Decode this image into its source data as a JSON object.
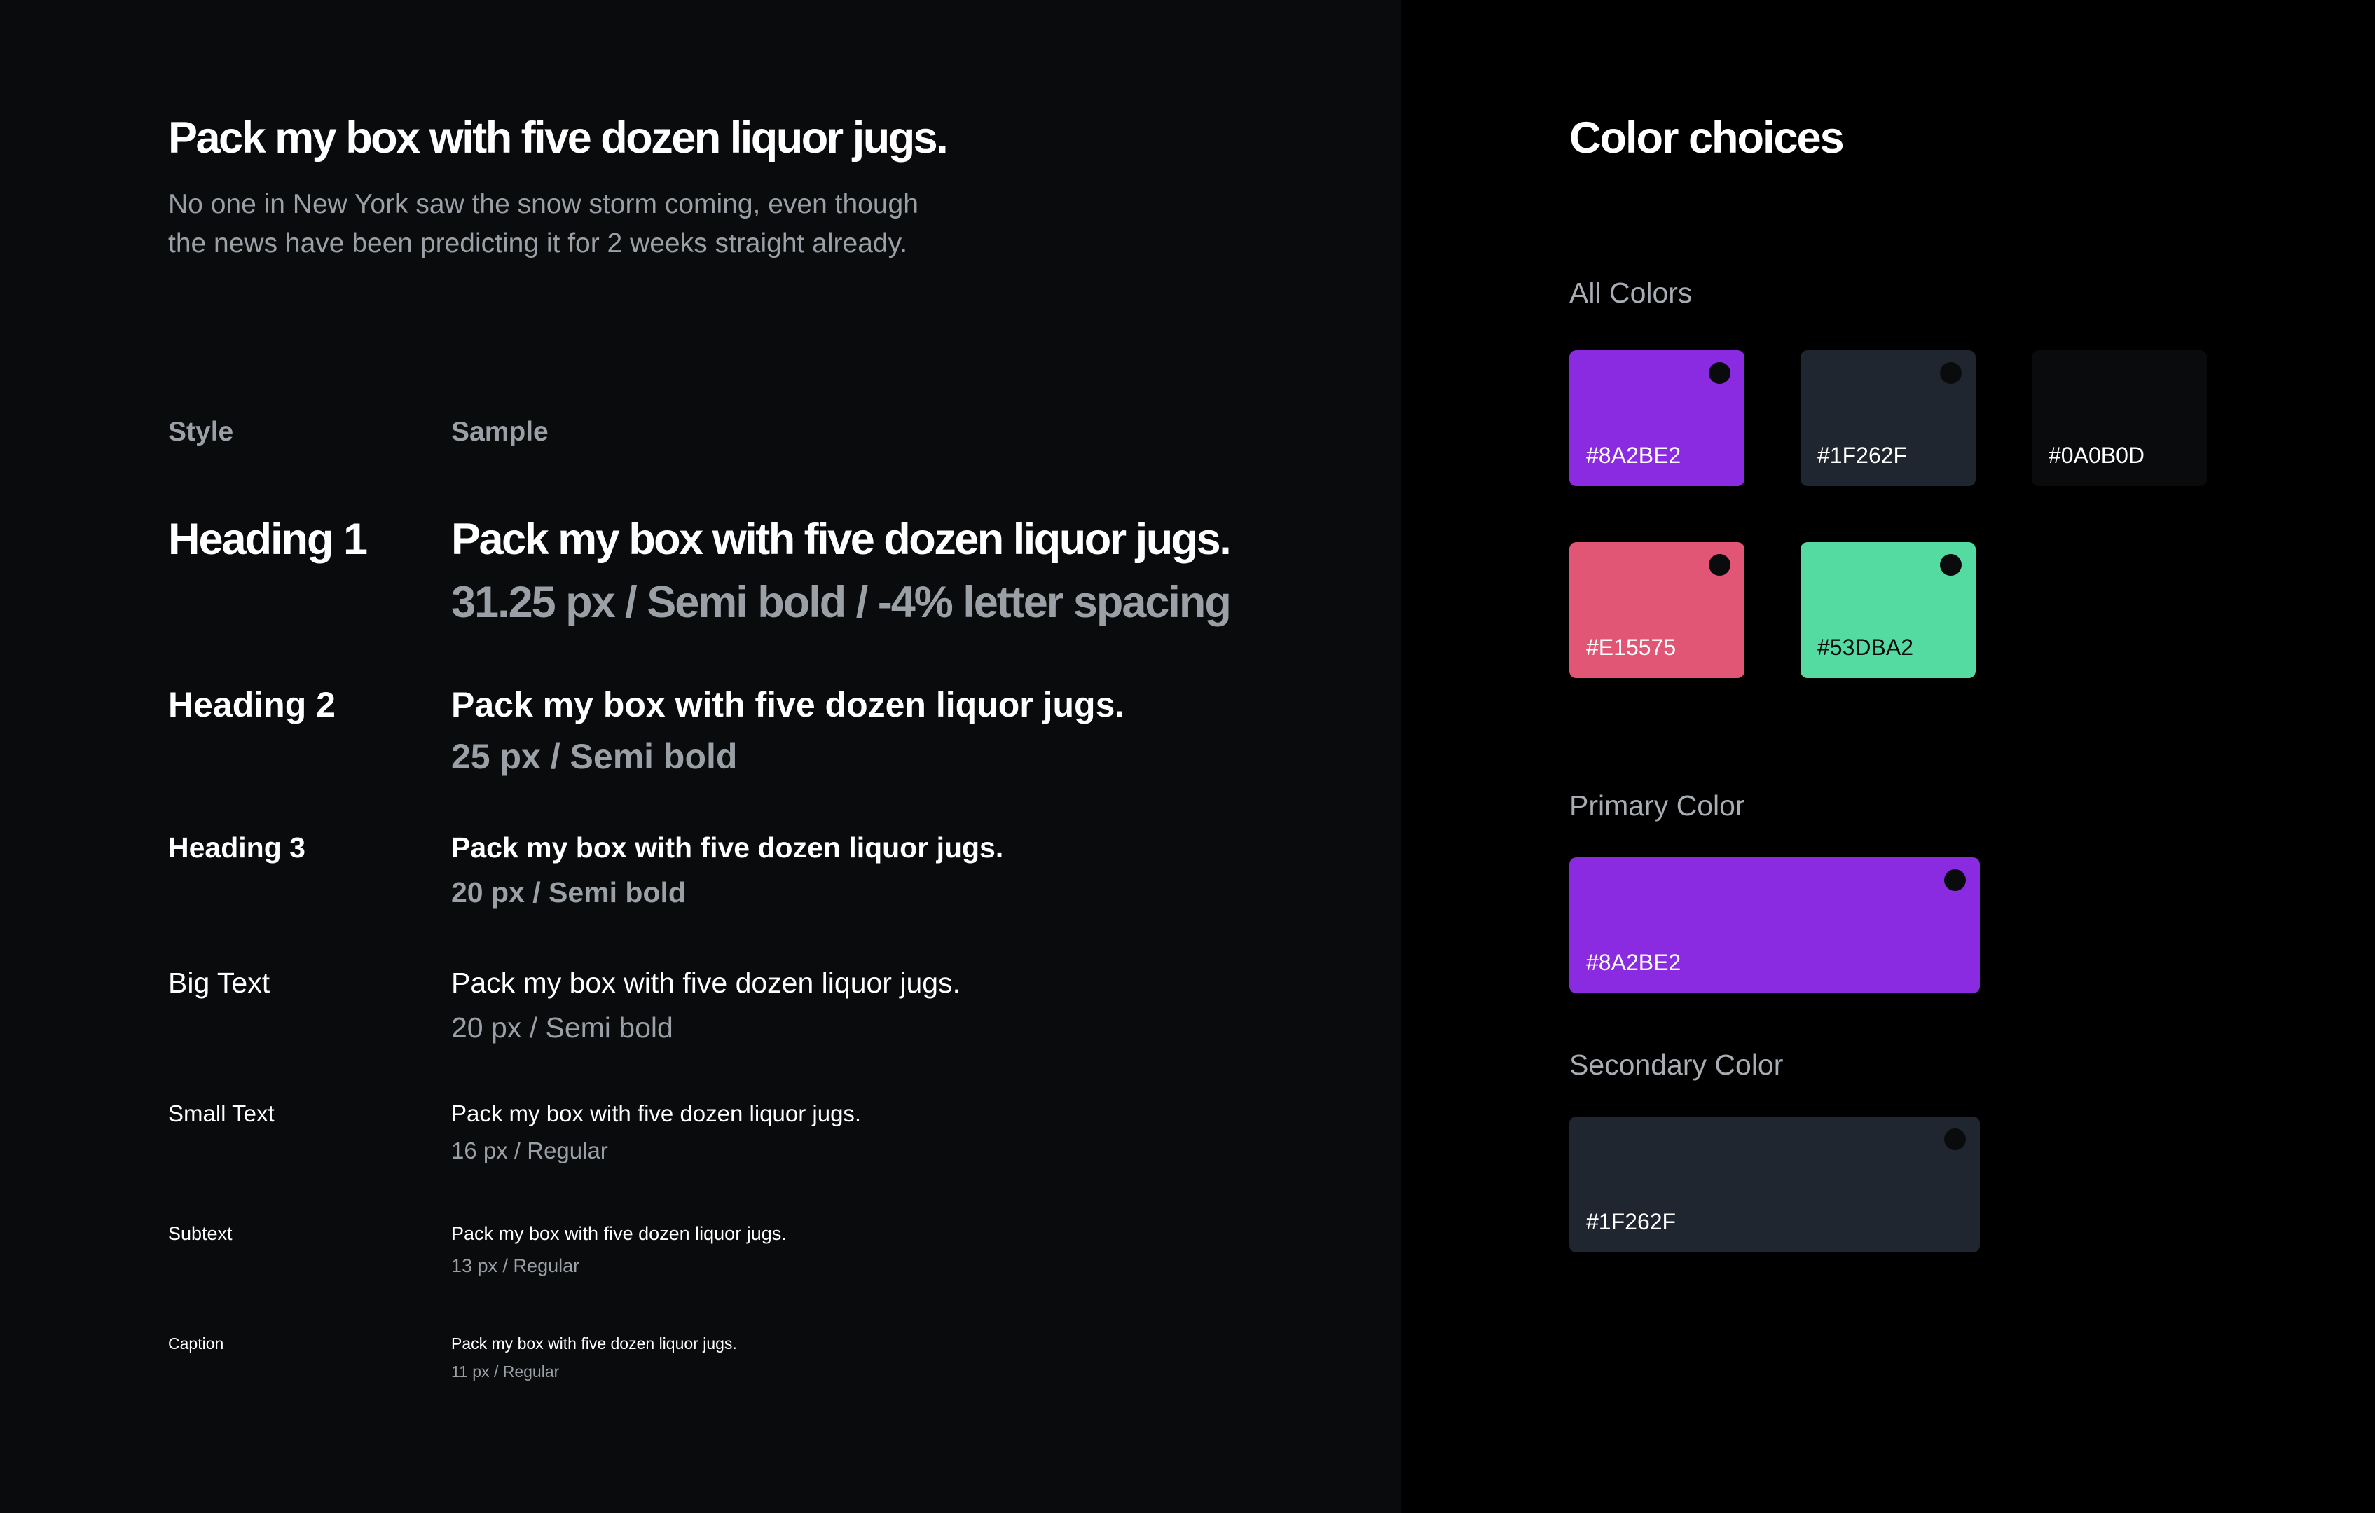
{
  "typography": {
    "intro_title": "Pack my box with five dozen liquor jugs.",
    "intro_description": "No one in New York saw the snow storm coming, even though the news have been predicting it for 2 weeks straight already.",
    "columns": {
      "style": "Style",
      "sample": "Sample"
    },
    "rows": [
      {
        "name": "Heading 1",
        "sample": "Pack my box with five dozen liquor jugs.",
        "meta": "31.25 px / Semi bold / -4% letter spacing"
      },
      {
        "name": "Heading 2",
        "sample": "Pack my box with five dozen liquor jugs.",
        "meta": "25 px / Semi bold"
      },
      {
        "name": "Heading 3",
        "sample": "Pack my box with five dozen liquor jugs.",
        "meta": "20 px / Semi bold"
      },
      {
        "name": "Big Text",
        "sample": "Pack my box with five dozen liquor jugs.",
        "meta": "20 px / Semi bold"
      },
      {
        "name": "Small Text",
        "sample": "Pack my box with five dozen liquor jugs.",
        "meta": "16 px / Regular"
      },
      {
        "name": "Subtext",
        "sample": "Pack my box with five dozen liquor jugs.",
        "meta": "13 px / Regular"
      },
      {
        "name": "Caption",
        "sample": "Pack my box with five dozen liquor jugs.",
        "meta": "11 px / Regular"
      }
    ]
  },
  "colors": {
    "title": "Color choices",
    "all_label": "All Colors",
    "all": [
      {
        "hex": "#8A2BE2",
        "text_color": "#ffffff"
      },
      {
        "hex": "#1F262F",
        "text_color": "#ffffff"
      },
      {
        "hex": "#0A0B0D",
        "text_color": "#ffffff"
      },
      {
        "hex": "#E15575",
        "text_color": "#ffffff"
      },
      {
        "hex": "#53DBA2",
        "text_color": "#0A0B0D"
      }
    ],
    "primary_label": "Primary Color",
    "primary": {
      "hex": "#8A2BE2",
      "text_color": "#ffffff"
    },
    "secondary_label": "Secondary Color",
    "secondary": {
      "hex": "#1F262F",
      "text_color": "#ffffff"
    }
  }
}
